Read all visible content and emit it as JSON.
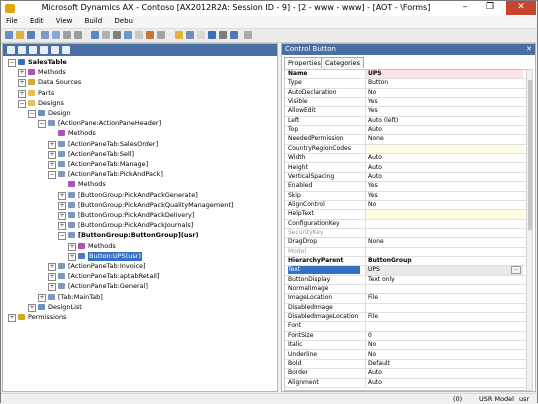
{
  "window": {
    "title": "Microsoft Dynamics AX - Contoso [AX2012R2A: Session ID - 9] - [2 - www - www] - [AOT - \\Forms]",
    "minimize": "–",
    "maximize": "❐",
    "close": "✕"
  },
  "menu": [
    "File",
    "Edit",
    "View",
    "Build",
    "Debu"
  ],
  "tree": [
    {
      "label": "SalesTable",
      "level": 0,
      "exp": "−",
      "icon": "form",
      "bold": true
    },
    {
      "label": "Methods",
      "level": 1,
      "exp": "+",
      "icon": "methods"
    },
    {
      "label": "Data Sources",
      "level": 1,
      "exp": "+",
      "icon": "datasource"
    },
    {
      "label": "Parts",
      "level": 1,
      "exp": "+",
      "icon": "folder"
    },
    {
      "label": "Designs",
      "level": 1,
      "exp": "−",
      "icon": "folder"
    },
    {
      "label": "Design",
      "level": 2,
      "exp": "−",
      "icon": "design"
    },
    {
      "label": "[ActionPane:ActionPaneHeader]",
      "level": 3,
      "exp": "−",
      "icon": "control"
    },
    {
      "label": "Methods",
      "level": 4,
      "exp": "",
      "icon": "methods"
    },
    {
      "label": "[ActionPaneTab:SalesOrder]",
      "level": 4,
      "exp": "+",
      "icon": "control"
    },
    {
      "label": "[ActionPaneTab:Sell]",
      "level": 4,
      "exp": "+",
      "icon": "control"
    },
    {
      "label": "[ActionPaneTab:Manage]",
      "level": 4,
      "exp": "+",
      "icon": "control"
    },
    {
      "label": "[ActionPaneTab:PickAndPack]",
      "level": 4,
      "exp": "−",
      "icon": "control"
    },
    {
      "label": "Methods",
      "level": 5,
      "exp": "",
      "icon": "methods"
    },
    {
      "label": "[ButtonGroup:PickAndPackGenerate]",
      "level": 5,
      "exp": "+",
      "icon": "control"
    },
    {
      "label": "[ButtonGroup:PickAndPackQualityManagement]",
      "level": 5,
      "exp": "+",
      "icon": "control"
    },
    {
      "label": "[ButtonGroup:PickAndPackDelivery]",
      "level": 5,
      "exp": "+",
      "icon": "control"
    },
    {
      "label": "[ButtonGroup:PickAndPackJournals]",
      "level": 5,
      "exp": "+",
      "icon": "control"
    },
    {
      "label": "[ButtonGroup:ButtonGroup](usr)",
      "level": 5,
      "exp": "−",
      "icon": "control",
      "bold": true
    },
    {
      "label": "Methods",
      "level": 6,
      "exp": "+",
      "icon": "methods"
    },
    {
      "label": "Button:UPS(usr)",
      "level": 6,
      "exp": "+",
      "icon": "button",
      "selected": true
    },
    {
      "label": "[ActionPaneTab:Invoice]",
      "level": 4,
      "exp": "+",
      "icon": "control"
    },
    {
      "label": "[ActionPaneTab:aptabRetail]",
      "level": 4,
      "exp": "+",
      "icon": "control"
    },
    {
      "label": "[ActionPaneTab:General]",
      "level": 4,
      "exp": "+",
      "icon": "control"
    },
    {
      "label": "[Tab:MainTab]",
      "level": 3,
      "exp": "+",
      "icon": "control"
    },
    {
      "label": "DesignList",
      "level": 2,
      "exp": "+",
      "icon": "design"
    },
    {
      "label": "Permissions",
      "level": 0,
      "exp": "+",
      "icon": "key"
    }
  ],
  "properties_panel": {
    "title": "Control Button",
    "close": "✕",
    "tabs": [
      "Properties",
      "Categories"
    ],
    "rows": [
      {
        "name": "Name",
        "value": "UPS",
        "style": "hdr"
      },
      {
        "name": "Type",
        "value": "Button"
      },
      {
        "name": "AutoDeclaration",
        "value": "No"
      },
      {
        "name": "Visible",
        "value": "Yes"
      },
      {
        "name": "AllowEdit",
        "value": "Yes"
      },
      {
        "name": "Left",
        "value": "Auto (left)"
      },
      {
        "name": "Top",
        "value": "Auto"
      },
      {
        "name": "NeededPermission",
        "value": "None"
      },
      {
        "name": "CountryRegionCodes",
        "value": "",
        "style": "yellow"
      },
      {
        "name": "Width",
        "value": "Auto"
      },
      {
        "name": "Height",
        "value": "Auto"
      },
      {
        "name": "VerticalSpacing",
        "value": "Auto"
      },
      {
        "name": "Enabled",
        "value": "Yes"
      },
      {
        "name": "Skip",
        "value": "Yes"
      },
      {
        "name": "AlignControl",
        "value": "No"
      },
      {
        "name": "HelpText",
        "value": "",
        "style": "yellow"
      },
      {
        "name": "ConfigurationKey",
        "value": ""
      },
      {
        "name": "SecurityKey",
        "value": "",
        "style": "grey"
      },
      {
        "name": "DragDrop",
        "value": "None"
      },
      {
        "name": "Model",
        "value": "",
        "style": "grey"
      },
      {
        "name": "HierarchyParent",
        "value": "ButtonGroup",
        "style": "bold"
      },
      {
        "name": "Text",
        "value": "UPS",
        "style": "selrow",
        "ellipsis": "..."
      },
      {
        "name": "ButtonDisplay",
        "value": "Text only"
      },
      {
        "name": "NormalImage",
        "value": ""
      },
      {
        "name": "ImageLocation",
        "value": "File"
      },
      {
        "name": "DisabledImage",
        "value": ""
      },
      {
        "name": "DisabledImageLocation",
        "value": "File"
      },
      {
        "name": "Font",
        "value": ""
      },
      {
        "name": "FontSize",
        "value": "0"
      },
      {
        "name": "Italic",
        "value": "No"
      },
      {
        "name": "Underline",
        "value": "No"
      },
      {
        "name": "Bold",
        "value": "Default"
      },
      {
        "name": "Border",
        "value": "Auto"
      },
      {
        "name": "Alignment",
        "value": "Auto"
      }
    ]
  },
  "status": {
    "counter": "(0)",
    "model": "USR Model",
    "user": "usr"
  }
}
